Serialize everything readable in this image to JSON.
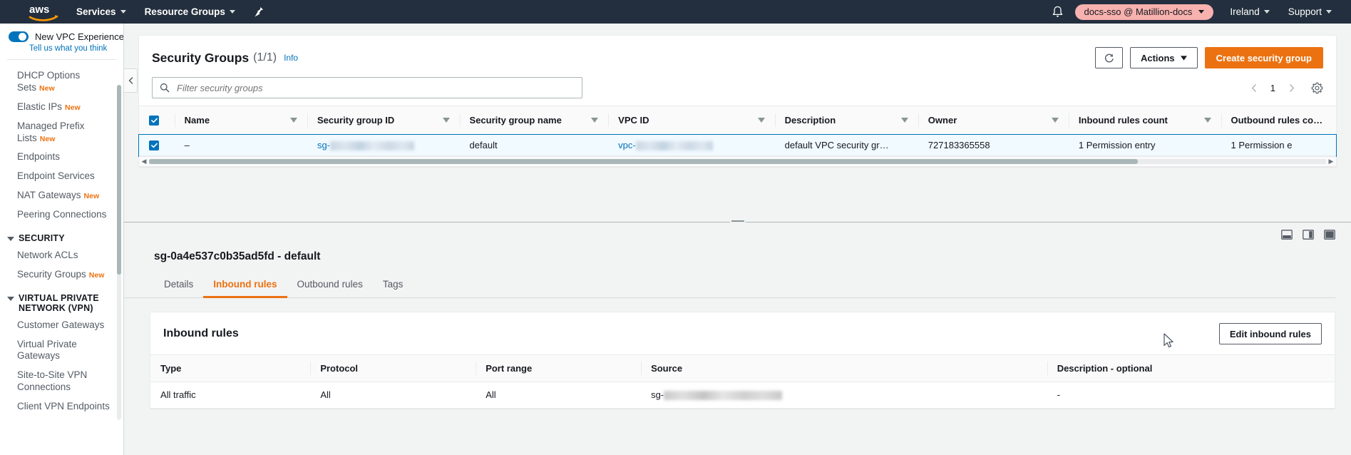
{
  "topnav": {
    "logo_alt": "aws",
    "services": "Services",
    "resource_groups": "Resource Groups",
    "pin_icon": "pin-icon",
    "bell_icon": "bell-icon",
    "account": "docs-sso @ Matillion-docs",
    "region": "Ireland",
    "support": "Support",
    "account_pill_color": "#f7b1ae",
    "bg_color": "#232f3e"
  },
  "sidebar": {
    "new_experience_label": "New VPC Experience",
    "tell_us_link": "Tell us what you think",
    "items": [
      {
        "label": "DHCP Options Sets",
        "badge": "New"
      },
      {
        "label": "Elastic IPs",
        "badge": "New"
      },
      {
        "label": "Managed Prefix Lists",
        "badge": "New"
      },
      {
        "label": "Endpoints",
        "badge": ""
      },
      {
        "label": "Endpoint Services",
        "badge": ""
      },
      {
        "label": "NAT Gateways",
        "badge": "New"
      },
      {
        "label": "Peering Connections",
        "badge": ""
      }
    ],
    "security_group_title": "SECURITY",
    "security_items": [
      {
        "label": "Network ACLs",
        "badge": ""
      },
      {
        "label": "Security Groups",
        "badge": "New"
      }
    ],
    "vpn_group_title": "VIRTUAL PRIVATE NETWORK (VPN)",
    "vpn_items": [
      {
        "label": "Customer Gateways",
        "badge": ""
      },
      {
        "label": "Virtual Private Gateways",
        "badge": ""
      },
      {
        "label": "Site-to-Site VPN Connections",
        "badge": ""
      },
      {
        "label": "Client VPN Endpoints",
        "badge": ""
      }
    ],
    "badge_color": "#ec7211"
  },
  "main": {
    "title": "Security Groups",
    "count": "(1/1)",
    "info": "Info",
    "refresh_icon": "refresh-icon",
    "actions_button": "Actions",
    "create_button": "Create security group",
    "create_button_color": "#ec7211",
    "search_placeholder": "Filter security groups",
    "search_value": "",
    "search_icon": "search-icon",
    "page_number": "1",
    "gear_icon": "gear-icon",
    "columns": [
      "Name",
      "Security group ID",
      "Security group name",
      "VPC ID",
      "Description",
      "Owner",
      "Inbound rules count",
      "Outbound rules count"
    ],
    "rows": [
      {
        "selected": true,
        "name": "–",
        "security_group_id_prefix": "sg-",
        "security_group_id_redacted": true,
        "security_group_name": "default",
        "vpc_id_prefix": "vpc-",
        "vpc_id_redacted": true,
        "description": "default VPC security gr…",
        "owner": "727183365558",
        "inbound_rules_count": "1 Permission entry",
        "outbound_rules_count": "1 Permission e"
      }
    ]
  },
  "detail": {
    "title": "sg-0a4e537c0b35ad5fd - default",
    "tabs": [
      {
        "label": "Details",
        "active": false
      },
      {
        "label": "Inbound rules",
        "active": true
      },
      {
        "label": "Outbound rules",
        "active": false
      },
      {
        "label": "Tags",
        "active": false
      }
    ],
    "active_tab_color": "#ec7211",
    "layout_icons": [
      "split-bottom-icon",
      "split-right-icon",
      "full-screen-icon"
    ],
    "inbound": {
      "panel_title": "Inbound rules",
      "edit_button": "Edit inbound rules",
      "columns": [
        "Type",
        "Protocol",
        "Port range",
        "Source",
        "Description - optional"
      ],
      "rows": [
        {
          "type": "All traffic",
          "protocol": "All",
          "port_range": "All",
          "source_prefix": "sg-",
          "source_redacted": true,
          "description": "-"
        }
      ]
    }
  }
}
